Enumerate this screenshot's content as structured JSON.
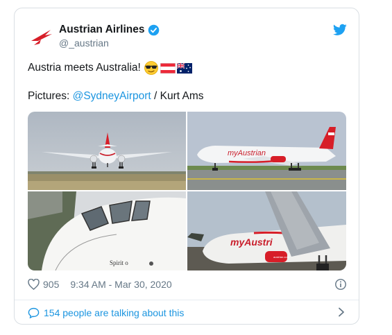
{
  "account": {
    "name": "Austrian Airlines",
    "handle": "@_austrian"
  },
  "tweet": {
    "text": "Austria meets Australia!",
    "emojis": [
      "sunglasses-face",
      "flag-austria",
      "flag-australia"
    ],
    "credit_prefix": "Pictures: ",
    "credit_mention": "@SydneyAirport",
    "credit_suffix": " / Kurt Ams"
  },
  "media": {
    "photos": [
      "plane-landing-photo",
      "plane-taxiing-photo",
      "cockpit-closeup-photo",
      "plane-tail-closeup-photo"
    ],
    "photo_text": [
      "myAustrian",
      "myAustrian",
      "Spirit o",
      "myAustri",
      "austrian.com"
    ]
  },
  "stats": {
    "likes": "905",
    "timestamp": "9:34 AM - Mar 30, 2020"
  },
  "conversation": {
    "label": "154 people are talking about this"
  },
  "colors": {
    "link": "#1b95e0",
    "text": "#14171a",
    "muted": "#657786",
    "brand_red": "#d71e28"
  }
}
